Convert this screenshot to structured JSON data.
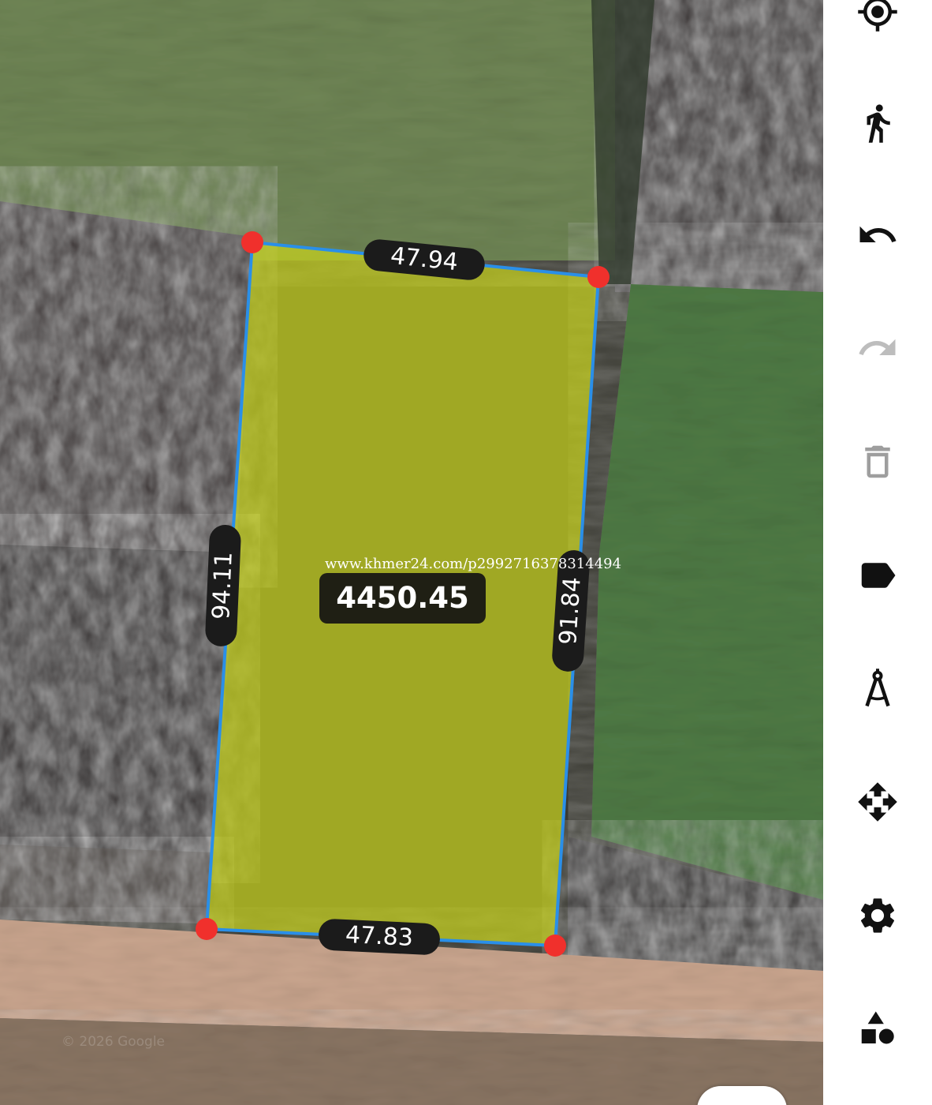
{
  "map": {
    "attribution": "© 2026 Google",
    "watermark": "www.khmer24.com/p2992716378314494",
    "area": "4450.45",
    "edges": {
      "top": "47.94",
      "left": "94.11",
      "right": "91.84",
      "bottom": "47.83"
    },
    "colors": {
      "polygon_fill": "#c8d21e",
      "polygon_stroke": "#2a8fe8",
      "vertex": "#f0302c"
    }
  },
  "toolbar": {
    "items": [
      {
        "name": "my-location-icon"
      },
      {
        "name": "walking-person-icon"
      },
      {
        "name": "undo-icon"
      },
      {
        "name": "redo-icon"
      },
      {
        "name": "delete-icon"
      },
      {
        "name": "label-tag-icon"
      },
      {
        "name": "compass-tool-icon"
      },
      {
        "name": "move-arrows-icon"
      },
      {
        "name": "settings-gear-icon"
      },
      {
        "name": "shapes-icon"
      }
    ]
  }
}
